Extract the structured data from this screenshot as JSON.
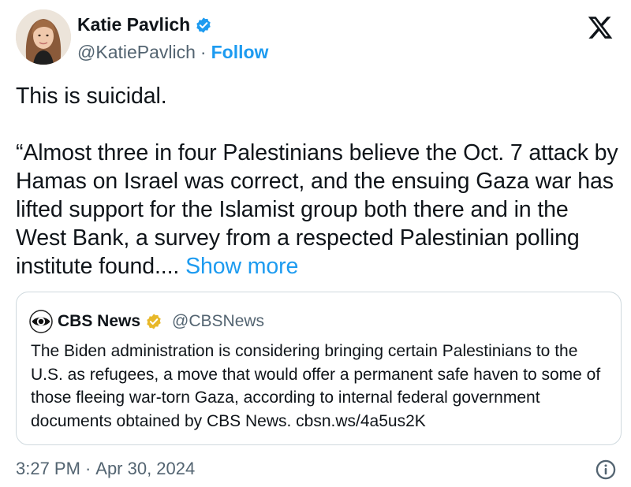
{
  "author": {
    "display_name": "Katie Pavlich",
    "handle": "@KatiePavlich",
    "separator": "·",
    "follow_label": "Follow",
    "verified_color": "#1d9bf0"
  },
  "tweet": {
    "line1": "This is suicidal.",
    "body": "“Almost three in four Palestinians believe the Oct. 7 attack by Hamas on Israel was correct, and the ensuing Gaza war has lifted support for the Islamist group both there and in the West Bank, a survey from a respected Palestinian polling institute found....",
    "show_more": "Show more"
  },
  "quote": {
    "name": "CBS News",
    "handle": "@CBSNews",
    "text": "The Biden administration is considering bringing certain Palestinians to the U.S. as refugees, a move that would offer a permanent safe haven to some of those fleeing war-torn Gaza, according to internal federal government documents obtained by CBS News. cbsn.ws/4a5us2K",
    "badge_color": "#e8b829"
  },
  "footer": {
    "time": "3:27 PM",
    "separator": "·",
    "date": "Apr 30, 2024"
  },
  "icons": {
    "brand": "x-logo-icon",
    "info": "info-icon",
    "verified": "verified-badge-icon",
    "quote_logo": "cbs-eye-icon"
  },
  "colors": {
    "link": "#1d9bf0",
    "secondary_text": "#536471",
    "border": "#cfd9de"
  }
}
